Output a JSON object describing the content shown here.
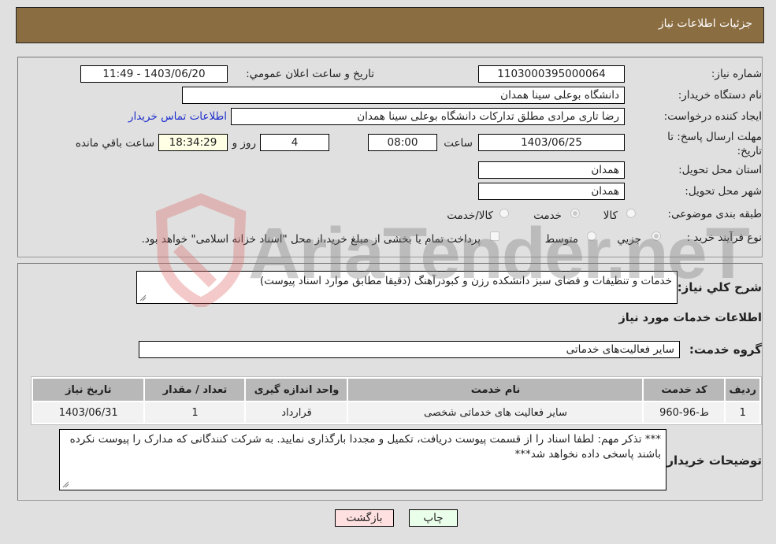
{
  "header": {
    "title": "جزئیات اطلاعات نیاز"
  },
  "details": {
    "need_number_label": "شماره نیاز:",
    "need_number": "1103000395000064",
    "announce_label": "تاریخ و ساعت اعلان عمومي:",
    "announce_value": "1403/06/20 - 11:49",
    "buyer_org_label": "نام دستگاه خریدار:",
    "buyer_org": "دانشگاه بوعلی سینا همدان",
    "creator_label": "ایجاد کننده درخواست:",
    "creator": "رضا تاری مرادی مطلق تدارکات دانشگاه بوعلی سینا همدان",
    "contact_link": "اطلاعات تماس خریدار",
    "deadline_label": "مهلت ارسال پاسخ: تا تاریخ:",
    "deadline_date": "1403/06/25",
    "time_label": "ساعت",
    "deadline_time": "08:00",
    "days_value": "4",
    "days_label": "روز و",
    "remaining_time": "18:34:29",
    "remaining_label": "ساعت باقي مانده",
    "province_label": "استان محل تحویل:",
    "province": "همدان",
    "city_label": "شهر محل تحویل:",
    "city": "همدان",
    "category_label": "طبقه بندی موضوعی:",
    "category_options": [
      {
        "label": "کالا",
        "checked": false
      },
      {
        "label": "خدمت",
        "checked": true
      },
      {
        "label": "کالا/خدمت",
        "checked": false
      }
    ],
    "process_label": "نوع فرآیند خرید :",
    "process_options": [
      {
        "label": "جزيي",
        "checked": true
      },
      {
        "label": "متوسط",
        "checked": false
      }
    ],
    "treasury_note": "پرداخت تمام یا بخشی از مبلغ خرید،از محل \"اسناد خزانه اسلامی\" خواهد بود."
  },
  "summary": {
    "label": "شرح کلي نیاز:",
    "text": "خدمات و تنظیفات و فضای سبز دانشکده رزن و کبودرآهنگ (دقیقا مطابق موارد اسناد پیوست)"
  },
  "services": {
    "section_title": "اطلاعات خدمات مورد نیاز",
    "group_label": "گروه خدمت:",
    "group_value": "سایر فعالیت‌های خدماتی",
    "table": {
      "headers": [
        "ردیف",
        "کد خدمت",
        "نام خدمت",
        "واحد اندازه گیری",
        "تعداد / مقدار",
        "تاریخ نیاز"
      ],
      "rows": [
        [
          "1",
          "ط-96-960",
          "سایر فعالیت های خدماتی شخصی",
          "قرارداد",
          "1",
          "1403/06/31"
        ]
      ]
    }
  },
  "buyer_notes": {
    "label": "توضیحات خریدار:",
    "text": "*** تذکر مهم: لطفا اسناد را از قسمت پیوست دریافت، تکمیل و مجددا بارگذاری نمایید. به شرکت کنندگانی که مدارک را پیوست نکرده باشند پاسخی داده نخواهد شد***"
  },
  "buttons": {
    "print": "چاپ",
    "back": "بازگشت"
  },
  "watermark": {
    "text": "AriaTender.neT"
  },
  "colors": {
    "header": "#8b6d42",
    "print_bg": "#eaffea",
    "back_bg": "#ffe0e0",
    "link": "#1f2fcc"
  }
}
